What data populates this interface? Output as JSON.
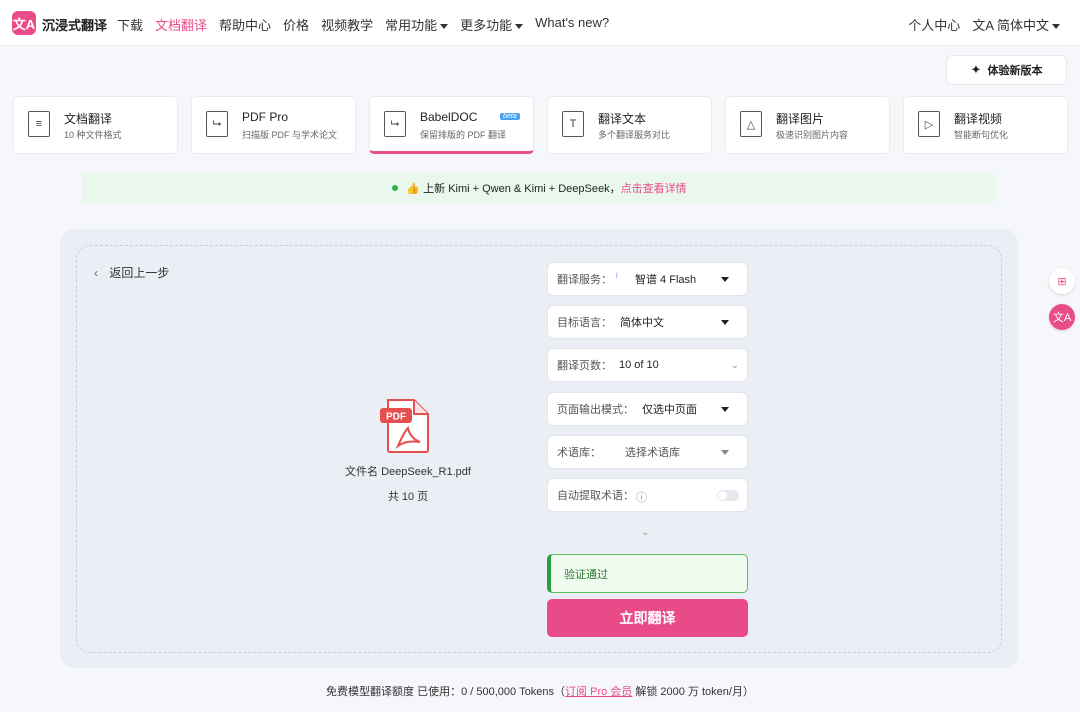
{
  "brand": {
    "logo": "文A",
    "name": "沉浸式翻译"
  },
  "nav": {
    "items": [
      "下载",
      "文档翻译",
      "帮助中心",
      "价格",
      "视频教学",
      "常用功能",
      "更多功能",
      "What's new?"
    ],
    "active_index": 1
  },
  "top_right": {
    "user_center": "个人中心",
    "language": "简体中文"
  },
  "try_new": "体验新版本",
  "cards": [
    {
      "title": "文档翻译",
      "sub": "10 种文件格式",
      "icon": "≡"
    },
    {
      "title": "PDF Pro",
      "sub": "扫描版 PDF 与学术论文",
      "icon": "⮡"
    },
    {
      "title": "BabelDOC",
      "sub": "保留排版的 PDF 翻译",
      "icon": "⮡",
      "badge": "beta"
    },
    {
      "title": "翻译文本",
      "sub": "多个翻译服务对比",
      "icon": "T"
    },
    {
      "title": "翻译图片",
      "sub": "极速识别图片内容",
      "icon": "△"
    },
    {
      "title": "翻译视频",
      "sub": "智能断句优化",
      "icon": "▷"
    }
  ],
  "notice": {
    "text": "👍 上新 Kimi + Qwen & Kimi + DeepSeek，",
    "link": "点击查看详情"
  },
  "back": "返回上一步",
  "file": {
    "name": "文件名 DeepSeek_R1.pdf",
    "pages": "共 10 页",
    "badge": "PDF"
  },
  "form": {
    "service": {
      "label": "翻译服务：",
      "value": "智谱 4 Flash",
      "info": "i"
    },
    "target": {
      "label": "目标语言：",
      "value": "简体中文"
    },
    "pages": {
      "label": "翻译页数：",
      "value": "10 of 10"
    },
    "output": {
      "label": "页面输出模式：",
      "value": "仅选中页面"
    },
    "glossary": {
      "label": "术语库：",
      "value": "选择术语库"
    },
    "auto_term": {
      "label": "自动提取术语：",
      "info": "ⓘ",
      "enabled": false
    }
  },
  "verify": "验证通过",
  "translate_btn": "立即翻译",
  "footer": {
    "prefix": "免费模型翻译额度 已使用：0 / 500,000 Tokens（",
    "link": "订阅 Pro 会员",
    "suffix": " 解锁 2000 万 token/月）"
  },
  "colors": {
    "accent": "#ea4c89",
    "success": "#2f9e38"
  }
}
